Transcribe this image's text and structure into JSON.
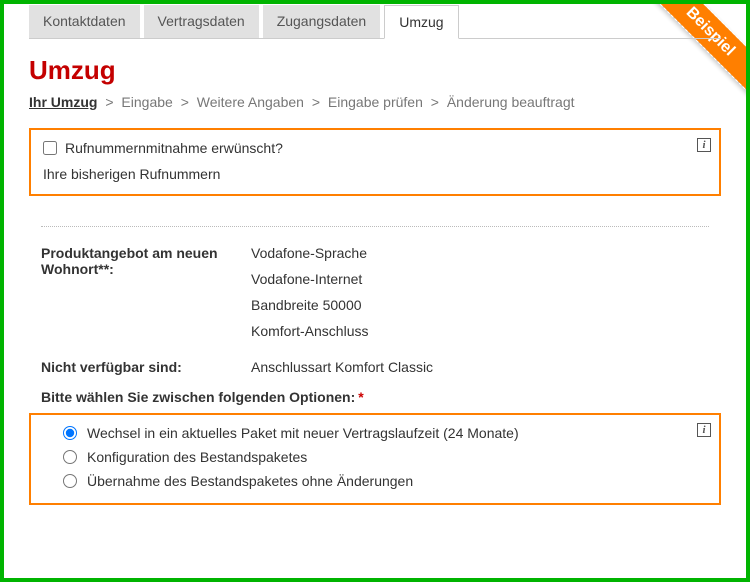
{
  "ribbon": {
    "label": "Beispiel"
  },
  "tabs": [
    {
      "label": "Kontaktdaten"
    },
    {
      "label": "Vertragsdaten"
    },
    {
      "label": "Zugangsdaten"
    },
    {
      "label": "Umzug"
    }
  ],
  "page_title": "Umzug",
  "breadcrumb": {
    "steps": [
      "Ihr Umzug",
      "Eingabe",
      "Weitere Angaben",
      "Eingabe prüfen",
      "Änderung beauftragt"
    ],
    "sep": ">"
  },
  "phone_portability": {
    "checkbox_label": "Rufnummernmitnahme erwünscht?",
    "sub_label": "Ihre bisherigen Rufnummern"
  },
  "product_offer": {
    "key": "Produktangebot am neuen Wohnort**:",
    "values": [
      "Vodafone-Sprache",
      "Vodafone-Internet",
      "Bandbreite 50000",
      "Komfort-Anschluss"
    ]
  },
  "not_available": {
    "key": "Nicht verfügbar sind:",
    "value": "Anschlussart Komfort Classic"
  },
  "options": {
    "heading": "Bitte wählen Sie zwischen folgenden Optionen:",
    "items": [
      "Wechsel in ein aktuelles Paket mit neuer Vertragslaufzeit (24 Monate)",
      "Konfiguration des Bestandspaketes",
      "Übernahme des Bestandspaketes ohne Änderungen"
    ]
  }
}
